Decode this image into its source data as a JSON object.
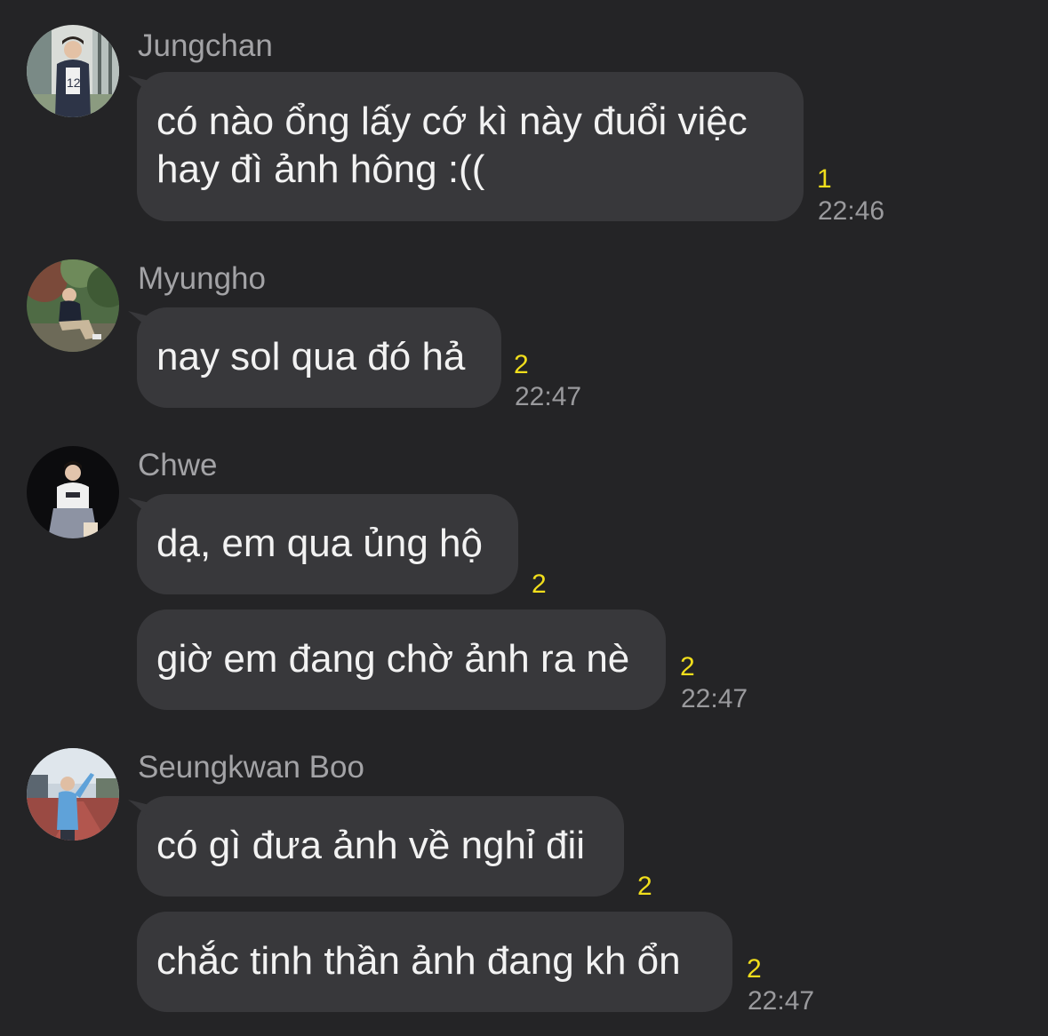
{
  "messages": [
    {
      "sender": "Jungchan",
      "bubbles": [
        {
          "lines": [
            "có nào ổng lấy cớ kì này đuổi việc",
            "hay đì ảnh hông :(("
          ],
          "unread": "1",
          "time": "22:46"
        }
      ]
    },
    {
      "sender": "Myungho",
      "bubbles": [
        {
          "lines": [
            "nay sol qua đó hả"
          ],
          "unread": "2",
          "time": "22:47"
        }
      ]
    },
    {
      "sender": "Chwe",
      "bubbles": [
        {
          "lines": [
            "dạ, em qua ủng hộ"
          ],
          "unread": "2",
          "time": ""
        },
        {
          "lines": [
            "giờ em đang chờ ảnh ra nè"
          ],
          "unread": "2",
          "time": "22:47"
        }
      ]
    },
    {
      "sender": "Seungkwan Boo",
      "bubbles": [
        {
          "lines": [
            "có gì đưa ảnh về nghỉ đii"
          ],
          "unread": "2",
          "time": ""
        },
        {
          "lines": [
            "chắc tinh thần ảnh đang kh ổn"
          ],
          "unread": "2",
          "time": "22:47"
        }
      ]
    }
  ],
  "colors": {
    "background": "#242426",
    "bubble": "#38383b",
    "message_text": "#f2f2f2",
    "sender_name": "#a3a3a6",
    "unread_count": "#f1de1c",
    "timestamp": "#9a9a9d"
  },
  "icons": [
    "avatar-photo-jungchan",
    "avatar-photo-myungho",
    "avatar-photo-chwe",
    "avatar-photo-seungkwan"
  ]
}
